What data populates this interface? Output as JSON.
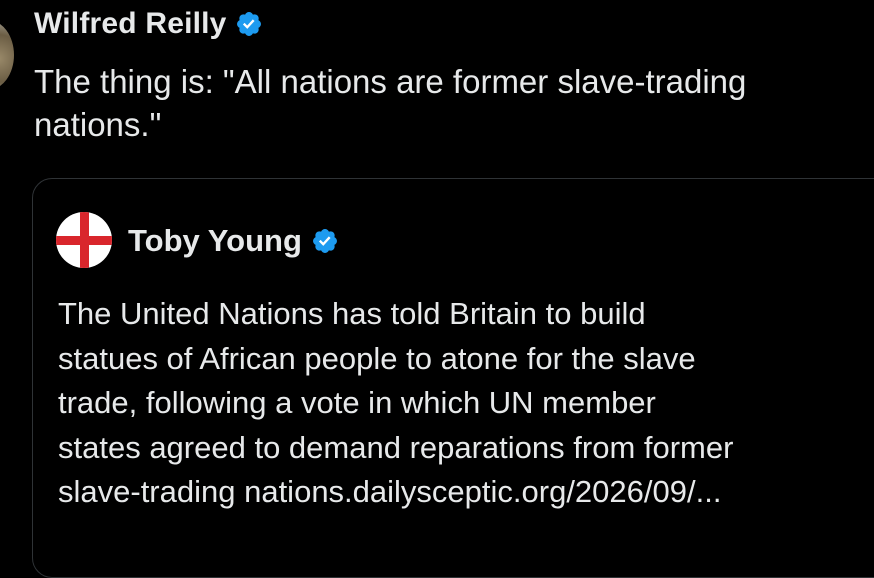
{
  "post": {
    "author_name": "Wilfred Reilly",
    "verified_icon": "verified-badge-icon",
    "text": "The thing is: \"All nations are former slave-trading nations.\""
  },
  "quoted_post": {
    "author_name": "Toby Young",
    "avatar": "england-flag-avatar",
    "verified_icon": "verified-badge-icon",
    "text_lines": [
      "The United Nations has told Britain to build",
      "statues of African people to atone for the slave",
      "trade, following a vote in which UN member",
      "states agreed to demand reparations from former",
      "slave-trading nations.dailysceptic.org/2026/09/..."
    ]
  },
  "colors": {
    "background": "#000000",
    "text": "#e7e9ea",
    "verified_blue": "#1d9bf0",
    "card_border": "#2f3336",
    "flag_red": "#d9262c"
  }
}
